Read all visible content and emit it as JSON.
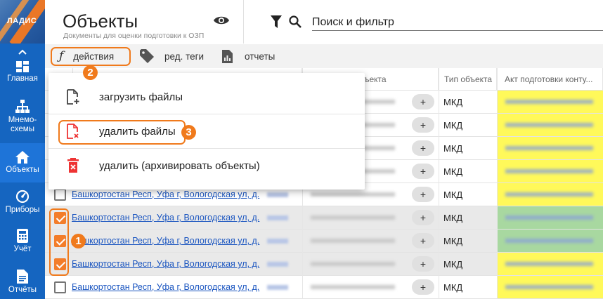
{
  "sidebar": {
    "logo": "ЛАДИС",
    "items": [
      {
        "label": "Главная"
      },
      {
        "label": "Мнемо-\nсхемы"
      },
      {
        "label": "Объекты"
      },
      {
        "label": "Приборы"
      },
      {
        "label": "Учёт"
      },
      {
        "label": "Отчёты"
      }
    ]
  },
  "header": {
    "title": "Объекты",
    "subtitle": "Документы для оценки подготовки к ОЗП",
    "search_placeholder": "Поиск и фильтр"
  },
  "toolbar": {
    "actions": "действия",
    "tags": "ред. теги",
    "reports": "отчеты"
  },
  "table": {
    "columns": [
      "ъекта",
      "Тип объекта",
      "Акт подготовки конту..."
    ],
    "rows": [
      {
        "address": "",
        "type": "МКД",
        "checked": false,
        "akt_color": "#fff95a"
      },
      {
        "address": "",
        "type": "МКД",
        "checked": false,
        "akt_color": "#fff95a"
      },
      {
        "address": "",
        "type": "МКД",
        "checked": false,
        "akt_color": "#fff95a"
      },
      {
        "address": "",
        "type": "МКД",
        "checked": false,
        "akt_color": "#fff95a"
      },
      {
        "address": "Башкортостан Респ, Уфа г, Вологодская ул, д.",
        "type": "МКД",
        "checked": false,
        "akt_color": "#fff95a"
      },
      {
        "address": "Башкортостан Респ, Уфа г, Вологодская ул, д.",
        "type": "МКД",
        "checked": true,
        "akt_color": "#a8d8a0"
      },
      {
        "address": "Башкортостан Респ, Уфа г, Вологодская ул, д.",
        "type": "МКД",
        "checked": true,
        "akt_color": "#a8d8a0"
      },
      {
        "address": "Башкортостан Респ, Уфа г, Вологодская ул, д.",
        "type": "МКД",
        "checked": true,
        "akt_color": "#fff95a"
      },
      {
        "address": "Башкортостан Респ, Уфа г, Вологодская ул, д.",
        "type": "МКД",
        "checked": false,
        "akt_color": "#fff95a"
      }
    ],
    "plus": "+"
  },
  "menu": {
    "upload": "загрузить файлы",
    "delete_files": "удалить файлы",
    "archive": "удалить (архивировать объекты)"
  },
  "badges": {
    "one": "1",
    "two": "2",
    "three": "3"
  },
  "colors": {
    "accent": "#f07a1c",
    "sidebar": "#1565c0",
    "checkbox": "#f37d2a"
  }
}
